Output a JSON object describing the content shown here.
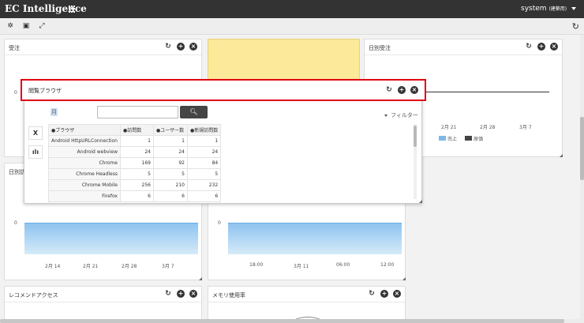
{
  "header": {
    "brand": "EC Intelligence",
    "user": "system",
    "user_note": "(建築用)"
  },
  "toolbar": {
    "settings_icon": "gear-icon",
    "save_icon": "save-icon",
    "expand_icon": "expand-icon",
    "refresh_icon": "refresh-icon"
  },
  "panels": {
    "orders": {
      "title": "受注",
      "y_zero": "0"
    },
    "daily_orders": {
      "title": "日別受注",
      "x_ticks": [
        "2月 21",
        "2月 28",
        "3月 7"
      ],
      "legend": [
        {
          "label": "売上",
          "color": "#7fb8e6"
        },
        {
          "label": "原価",
          "color": "#444444"
        }
      ]
    },
    "daily_left": {
      "title": "日別訪",
      "y_zero": "0",
      "x_ticks": [
        "2月 14",
        "2月 21",
        "2月 28",
        "3月 7"
      ]
    },
    "hourly": {
      "y_zero": "0",
      "x_ticks": [
        "18:00",
        "3月 11",
        "06:00",
        "12:00"
      ]
    },
    "recommend": {
      "title": "レコメンドアクセス"
    },
    "memory": {
      "title": "メモリ使用率"
    }
  },
  "overlay": {
    "title": "閲覧ブラウザ",
    "period": "月",
    "search_value": "",
    "filter_label": "フィルター",
    "columns": [
      "●ブラウザ",
      "●訪問数",
      "●ユーザー数",
      "●新規訪問数"
    ],
    "rows": [
      [
        "Android HttpURLConnection",
        "1",
        "1",
        "1"
      ],
      [
        "Android webview",
        "24",
        "24",
        "24"
      ],
      [
        "Chrome",
        "169",
        "92",
        "84"
      ],
      [
        "Chrome Headless",
        "5",
        "5",
        "5"
      ],
      [
        "Chrome Mobile",
        "256",
        "210",
        "232"
      ],
      [
        "Firefox",
        "6",
        "6",
        "6"
      ]
    ]
  },
  "colors": {
    "highlight": "#e00012",
    "accent_area": "#8ec3ef",
    "sticky": "#fce99a"
  }
}
